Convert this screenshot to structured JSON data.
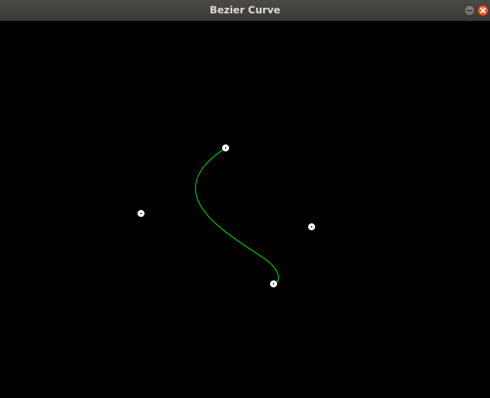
{
  "window": {
    "title": "Bezier Curve",
    "buttons": {
      "minimize_icon": "minimize-icon",
      "close_icon": "close-icon"
    }
  },
  "canvas": {
    "background_color": "#000000",
    "curve": {
      "type": "cubic-bezier",
      "color": "#00e000"
    },
    "control_point_color": "#ffffff"
  }
}
